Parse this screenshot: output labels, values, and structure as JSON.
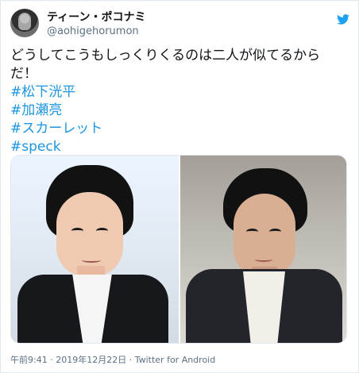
{
  "user": {
    "display_name": "ティーン・ポコナミ",
    "handle": "@aohigehorumon"
  },
  "tweet": {
    "text_line_1": "どうしてこうもしっくりくるのは二人が似てるから",
    "text_line_2": "だ！",
    "hashtags": [
      "#松下洸平",
      "#加瀬亮",
      "#スカーレット",
      "#speck"
    ]
  },
  "meta": {
    "time": "午前9:41",
    "separator_1": " · ",
    "date": "2019年12月22日",
    "separator_2": " · ",
    "source": "Twitter for Android"
  },
  "icons": {
    "avatar": "profile-avatar",
    "brand": "twitter-bird-icon"
  },
  "colors": {
    "hashtag": "#1b95e0",
    "brand": "#1da1f2",
    "secondary_text": "#5b7083"
  }
}
